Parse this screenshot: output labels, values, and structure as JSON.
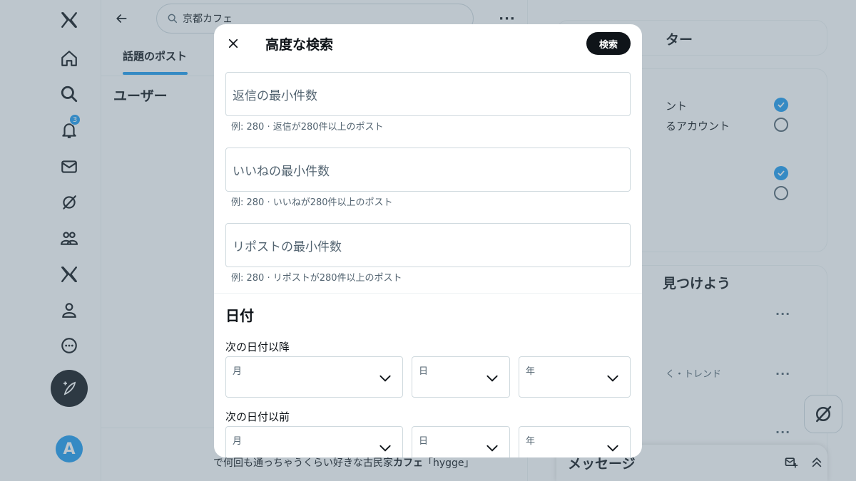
{
  "search": {
    "query": "京都カフェ"
  },
  "nav": {
    "notification_count": "3",
    "avatar_letter": "A"
  },
  "center": {
    "tab_active": "話題のポスト",
    "section_users": "ユーザー",
    "bottom_text_prefix": "で何回も通っちゃうくらい好きな古民家",
    "bottom_text_bold": "カフェ",
    "bottom_text_suffix": "「hygge」"
  },
  "right": {
    "filter_title_partial": "ター",
    "filter_option_1_partial": "ント",
    "filter_option_2_partial": "るアカウント",
    "discover_title_partial": "見つけよう",
    "trend_partial": "く・トレンド",
    "messages_title": "メッセージ"
  },
  "modal": {
    "title": "高度な検索",
    "search_button": "検索",
    "fields": [
      {
        "label": "返信の最小件数",
        "hint": "例: 280 · 返信が280件以上のポスト"
      },
      {
        "label": "いいねの最小件数",
        "hint": "例: 280 · いいねが280件以上のポスト"
      },
      {
        "label": "リポストの最小件数",
        "hint": "例: 280 · リポストが280件以上のポスト"
      }
    ],
    "date_heading": "日付",
    "since_label": "次の日付以降",
    "until_label": "次の日付以前",
    "selects": {
      "month": "月",
      "day": "日",
      "year": "年"
    }
  }
}
